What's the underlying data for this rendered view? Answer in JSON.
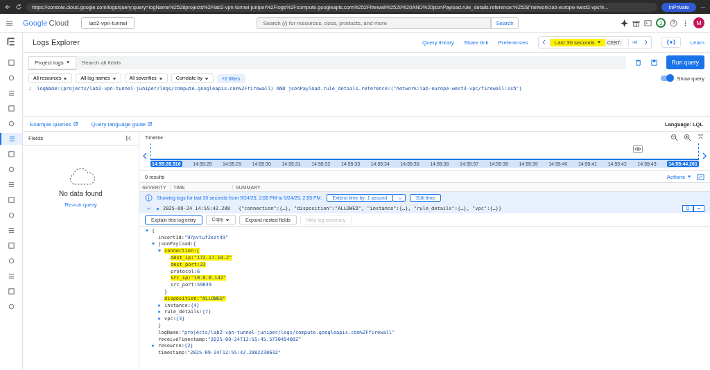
{
  "browser": {
    "url": "https://console.cloud.google.com/logs/query;query=logName%2528projects%2Flab2-vpn-tunnel-juniper%2Flogs%2Fcompute.googleapis.com%252Ffirewall%2529%20AND%20jsonPayload.rule_details.reference:%2528\"network:lab-europe-west3-vpc%...",
    "profile": "InPrivate",
    "more": "···"
  },
  "header": {
    "logo_brand": "Google",
    "logo_product": "Cloud",
    "project": "lab2-vpn-tunnel",
    "search_placeholder": "Search (/) for resources, docs, products, and more",
    "search_button": "Search",
    "notifications": "3",
    "avatar": "M"
  },
  "rail": [
    {
      "selected": false
    },
    {
      "selected": false
    },
    {
      "selected": false
    },
    {
      "selected": false
    },
    {
      "selected": false
    },
    {
      "selected": true
    },
    {
      "selected": false
    },
    {
      "selected": false
    },
    {
      "selected": false
    },
    {
      "selected": false
    },
    {
      "selected": false
    },
    {
      "selected": false
    },
    {
      "selected": false
    },
    {
      "selected": false
    },
    {
      "selected": false
    },
    {
      "selected": false
    },
    {
      "selected": false
    }
  ],
  "title_bar": {
    "title": "Logs Explorer",
    "links": [
      "Query library",
      "Share link",
      "Preferences"
    ],
    "time_range": "Last 30 seconds",
    "time_range_highlighted": true,
    "timezone": "CEST",
    "learn": "Learn"
  },
  "query_bar": {
    "scope": "Project logs",
    "search_placeholder": "Search all fields",
    "run": "Run query"
  },
  "filters": [
    {
      "label": "All resources",
      "kind": "dropdown"
    },
    {
      "label": "All log names",
      "kind": "dropdown"
    },
    {
      "label": "All severities",
      "kind": "dropdown"
    },
    {
      "label": "Correlate by",
      "kind": "dropdown"
    },
    {
      "label": "+2 filters",
      "kind": "more"
    }
  ],
  "show_query": {
    "label": "Show query",
    "on": true
  },
  "editor": {
    "line": "1",
    "query": "logName:(projects/lab2-vpn-tunnel-juniper/logs/compute.googleapis.com%2Ffirewall) AND jsonPayload.rule_details.reference:(\"network:lab-europe-west3-vpc/firewall:ssh\")"
  },
  "editor_links": [
    "Example queries",
    "Query language guide"
  ],
  "language": "Language: LQL",
  "fields": {
    "title": "Fields",
    "message": "No data found",
    "action": "Re-run query"
  },
  "timeline": {
    "title": "Timeline",
    "start": "14:55:26.516",
    "end": "14:55:44.261",
    "ticks": [
      "14:55:28",
      "14:55:29",
      "14:55:30",
      "14:55:31",
      "14:55:32",
      "14:55:33",
      "14:55:34",
      "14:55:35",
      "14:55:36",
      "14:55:37",
      "14:55:38",
      "14:55:39",
      "14:55:40",
      "14:55:41",
      "14:55:42",
      "14:55:43"
    ]
  },
  "results": {
    "count": "0 results",
    "actions": "Actions",
    "columns": [
      "SEVERITY",
      "TIME",
      "SUMMARY"
    ]
  },
  "banner": {
    "text": "Showing logs for last 30 seconds from 9/24/25, 2:55 PM to 9/24/25, 2:55 PM.",
    "extend": "Extend time by: 1 second",
    "edit": "Edit time"
  },
  "entry": {
    "expanded": true,
    "time": "2025-09-24 14:55:42.288",
    "summary": "{\"connection\":{…}, \"disposition\":\"ALLOWED\", \"instance\":{…}, \"rule_details\":{…}, \"vpc\":{…}}"
  },
  "entry_actions": [
    {
      "label": "Explain this log entry",
      "kind": "explain",
      "disabled": false
    },
    {
      "label": "Copy",
      "kind": "copy",
      "disabled": false
    },
    {
      "label": "Expand nested fields",
      "kind": "expand",
      "disabled": false
    },
    {
      "label": "Hide log summary",
      "kind": "hide",
      "disabled": true
    }
  ],
  "tree": {
    "value": "{",
    "expanded": true,
    "highlighted": false,
    "children": [
      {
        "key": "insertId:",
        "value": "\"97pvtuf2ezt49\"",
        "highlighted": false
      },
      {
        "key": "jsonPayload:",
        "value": "{",
        "expanded": true,
        "highlighted": false,
        "close": "}",
        "children": [
          {
            "key": "connection:",
            "value": "{",
            "expanded": true,
            "highlighted": true,
            "close": "}",
            "children": [
              {
                "key": "dest_ip:",
                "value": "\"172.17.10.2\"",
                "highlighted": true
              },
              {
                "key": "dest_port:",
                "value": "22",
                "highlighted": true
              },
              {
                "key": "protocol:",
                "value": "6",
                "highlighted": false
              },
              {
                "key": "src_ip:",
                "value": "\"10.0.0.142\"",
                "highlighted": true
              },
              {
                "key": "src_port:",
                "value": "59039",
                "highlighted": false
              }
            ]
          },
          {
            "key": "disposition:",
            "value": "\"ALLOWED\"",
            "highlighted": true
          },
          {
            "key": "instance:",
            "value": "{4}",
            "expanded": false,
            "highlighted": false
          },
          {
            "key": "rule_details:",
            "value": "{7}",
            "expanded": false,
            "highlighted": false
          },
          {
            "key": "vpc:",
            "value": "{3}",
            "expanded": false,
            "highlighted": false
          }
        ]
      },
      {
        "key": "logName:",
        "value": "\"projects/lab2-vpn-tunnel-juniper/logs/compute.googleapis.com%2Ffirewall\"",
        "highlighted": false
      },
      {
        "key": "receiveTimestamp:",
        "value": "\"2025-09-24T12:55:45.573049408Z\"",
        "highlighted": false
      },
      {
        "key": "resource:",
        "value": "{2}",
        "expanded": false,
        "highlighted": false
      },
      {
        "key": "timestamp:",
        "value": "\"2025-09-24T12:55:42.288223863Z\"",
        "highlighted": false
      }
    ]
  }
}
